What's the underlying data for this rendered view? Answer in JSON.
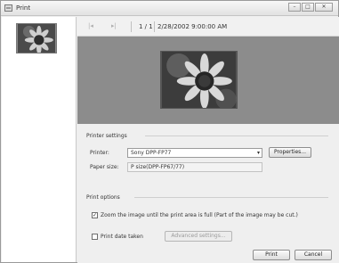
{
  "window": {
    "title": "Print"
  },
  "toolbar": {
    "page_number": "1 / 1",
    "datetime": "2/28/2002 9:00:00 AM"
  },
  "printer_settings": {
    "heading": "Printer settings",
    "printer_label": "Printer:",
    "printer_value": "Sony DPP-FP77",
    "properties_button": "Properties...",
    "paper_size_label": "Paper size:",
    "paper_size_value": "P size(DPP-FP67/77)"
  },
  "print_options": {
    "heading": "Print options",
    "zoom_checked": true,
    "zoom_label": "Zoom the image until the print area is full (Part of the image may be cut.)",
    "print_date_checked": false,
    "print_date_label": "Print date taken",
    "advanced_button": "Advanced settings..."
  },
  "footer": {
    "print_button": "Print",
    "cancel_button": "Cancel"
  }
}
